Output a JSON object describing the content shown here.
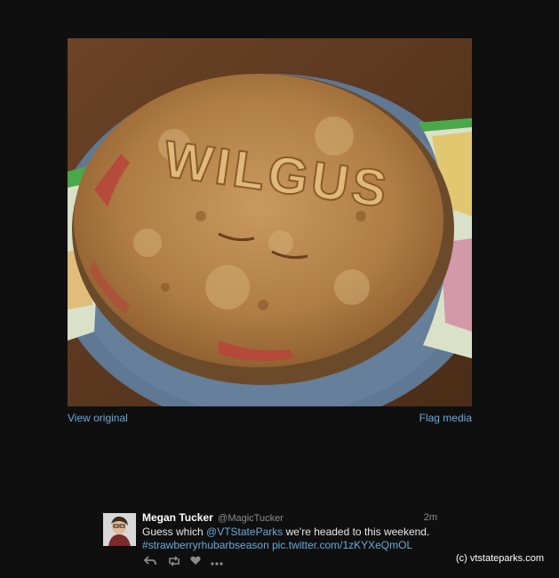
{
  "media": {
    "view_original": "View original",
    "flag_media": "Flag media",
    "pie_lettering": "WILGUS"
  },
  "tweet": {
    "fullname": "Megan Tucker",
    "username": "@MagicTucker",
    "timestamp": "2m",
    "text_before": "Guess which ",
    "mention": "@VTStateParks",
    "text_after": " we're headed to this weekend.",
    "hashtag": "#strawberryrhubarbseason",
    "pic_link": "pic.twitter.com/1zKYXeQmOL"
  },
  "actions": {
    "reply_icon": "reply-icon",
    "retweet_icon": "retweet-icon",
    "like_icon": "heart-icon",
    "more_icon": "more-icon"
  },
  "watermark": "(c) vtstateparks.com",
  "colors": {
    "background": "#0f0f0f",
    "link": "#6aa9d8",
    "muted": "#8b8b8b"
  }
}
